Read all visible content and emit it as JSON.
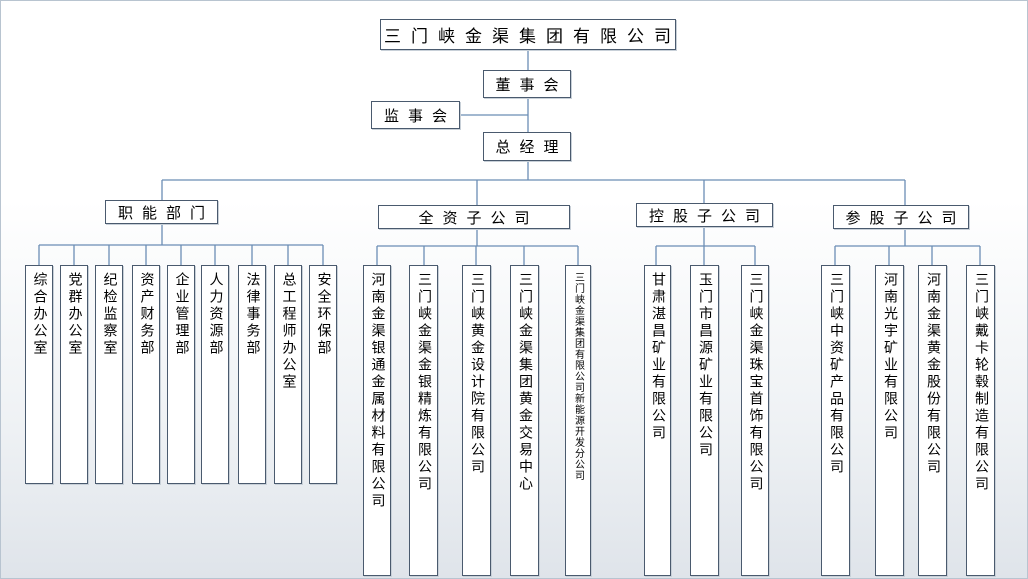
{
  "root": "三门峡金渠集团有限公司",
  "board": "董事会",
  "supervisors": "监事会",
  "gm": "总经理",
  "groups": {
    "functional": {
      "label": "职能部门",
      "items": [
        "综合办公室",
        "党群办公室",
        "纪检监察室",
        "资产财务部",
        "企业管理部",
        "人力资源部",
        "法律事务部",
        "总工程师办公室",
        "安全环保部"
      ]
    },
    "wholly_owned": {
      "label": "全资子公司",
      "items": [
        "河南金渠银通金属材料有限公司",
        "三门峡金渠金银精炼有限公司",
        "三门峡黄金设计院有限公司",
        "三门峡金渠集团黄金交易中心",
        "三门峡金渠集团有限公司新能源开发分公司"
      ]
    },
    "holding": {
      "label": "控股子公司",
      "items": [
        "甘肃湛昌矿业有限公司",
        "玉门市昌源矿业有限公司",
        "三门峡金渠珠宝首饰有限公司"
      ]
    },
    "participating": {
      "label": "参股子公司",
      "items": [
        "三门峡中资矿产品有限公司",
        "河南光宇矿业有限公司",
        "河南金渠黄金股份有限公司",
        "三门峡戴卡轮毂制造有限公司"
      ]
    }
  }
}
